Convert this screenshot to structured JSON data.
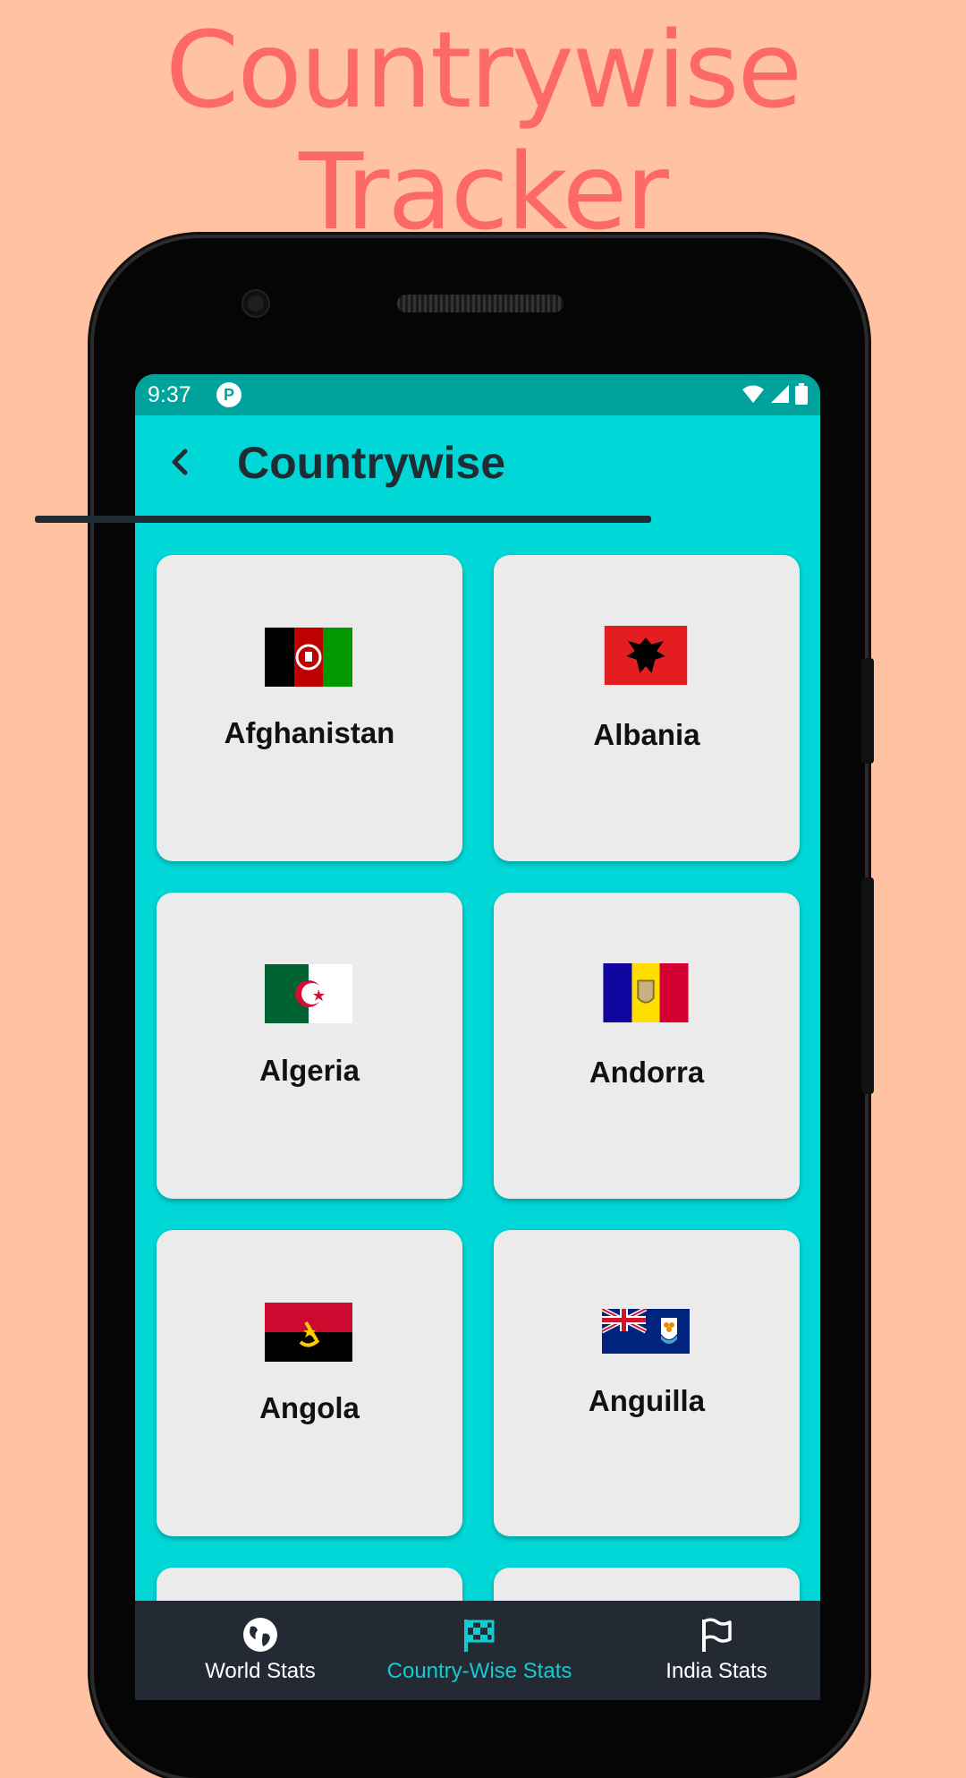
{
  "promo": {
    "title_line1": "Countrywise",
    "title_line2": "Tracker"
  },
  "status_bar": {
    "time": "9:37"
  },
  "app_bar": {
    "title": "Countrywise"
  },
  "countries": [
    {
      "name": "Afghanistan"
    },
    {
      "name": "Albania"
    },
    {
      "name": "Algeria"
    },
    {
      "name": "Andorra"
    },
    {
      "name": "Angola"
    },
    {
      "name": "Anguilla"
    }
  ],
  "bottom_nav": {
    "items": [
      {
        "label": "World Stats",
        "icon": "globe-icon"
      },
      {
        "label": "Country-Wise Stats",
        "icon": "checkered-flag-icon",
        "active": true
      },
      {
        "label": "India Stats",
        "icon": "flag-icon"
      }
    ]
  },
  "colors": {
    "background": "#ffc2a2",
    "promo_text": "#fd6a66",
    "screen_bg": "#00d7d6",
    "status_bar": "#00a29c",
    "card_bg": "#ebebeb",
    "nav_bg": "#232a34",
    "nav_active": "#12ccd1"
  }
}
